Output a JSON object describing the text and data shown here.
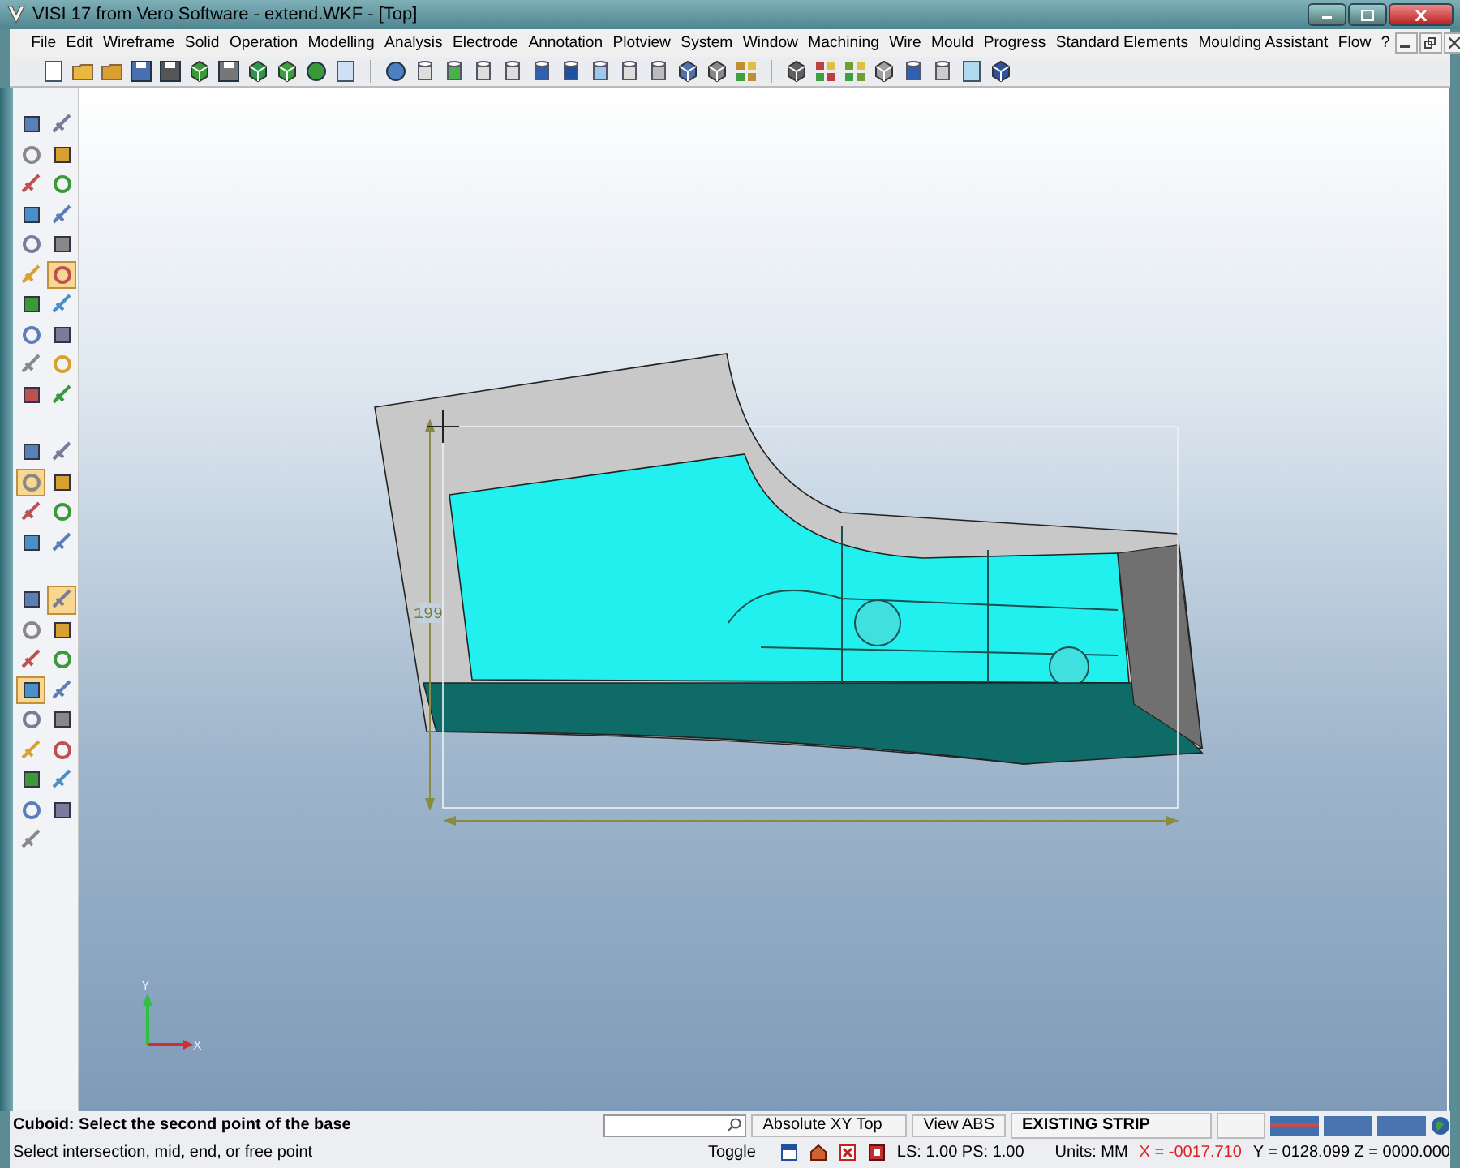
{
  "window": {
    "title": "VISI 17 from Vero Software - extend.WKF - [Top]"
  },
  "menu": [
    "File",
    "Edit",
    "Wireframe",
    "Solid",
    "Operation",
    "Modelling",
    "Analysis",
    "Electrode",
    "Annotation",
    "Plotview",
    "System",
    "Window",
    "Machining",
    "Wire",
    "Mould",
    "Progress",
    "Standard Elements",
    "Moulding Assistant",
    "Flow",
    "?"
  ],
  "left_toolbar": {
    "groups": [
      [
        {
          "selected": false
        },
        {
          "selected": false
        },
        {
          "selected": false
        },
        {
          "selected": false
        },
        {
          "selected": false
        },
        {
          "selected": false
        },
        {
          "selected": false
        },
        {
          "selected": false
        },
        {
          "selected": false
        },
        {
          "selected": false
        },
        {
          "selected": false
        },
        {
          "selected": true
        },
        {
          "selected": false
        },
        {
          "selected": false
        },
        {
          "selected": false
        },
        {
          "selected": false
        },
        {
          "selected": false
        },
        {
          "selected": false
        },
        {
          "selected": false
        },
        {
          "selected": false
        }
      ],
      [
        {
          "selected": false
        },
        {
          "selected": false
        },
        {
          "selected": true
        },
        {
          "selected": false
        },
        {
          "selected": false
        },
        {
          "selected": false
        },
        {
          "selected": false
        },
        {
          "selected": false
        }
      ],
      [
        {
          "selected": false
        },
        {
          "selected": true
        },
        {
          "selected": false
        },
        {
          "selected": false
        },
        {
          "selected": false
        },
        {
          "selected": false
        },
        {
          "selected": true
        },
        {
          "selected": false
        },
        {
          "selected": false
        },
        {
          "selected": false
        },
        {
          "selected": false
        },
        {
          "selected": false
        },
        {
          "selected": false
        },
        {
          "selected": false
        },
        {
          "selected": false
        },
        {
          "selected": false
        },
        {
          "selected": false
        }
      ]
    ]
  },
  "viewport": {
    "dimension": "199",
    "axes": {
      "x": "X",
      "y": "Y"
    }
  },
  "status_bar": {
    "prompt": "Cuboid: Select the second point of the base",
    "hint": "Select intersection, mid, end, or free point",
    "view": "Absolute XY Top",
    "view_mode": "View ABS",
    "layer": "EXISTING STRIP",
    "toggle": "Toggle",
    "scale": "LS: 1.00 PS: 1.00",
    "units": "Units: MM",
    "x": "X = -0017.710",
    "yz": "Y = 0128.099 Z = 0000.000"
  }
}
